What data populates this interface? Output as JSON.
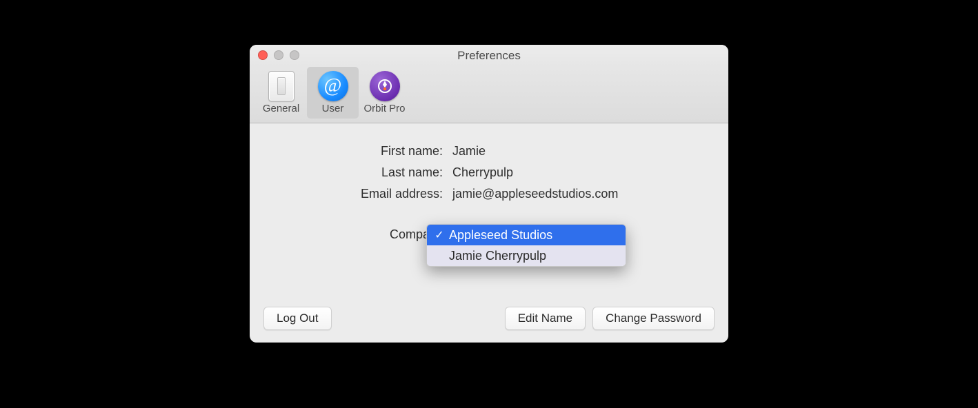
{
  "window": {
    "title": "Preferences"
  },
  "tabs": {
    "general": "General",
    "user": "User",
    "orbit": "Orbit Pro"
  },
  "form": {
    "first_name_label": "First name:",
    "first_name_value": "Jamie",
    "last_name_label": "Last name:",
    "last_name_value": "Cherrypulp",
    "email_label": "Email address:",
    "email_value": "jamie@appleseedstudios.com",
    "company_label": "Company"
  },
  "company_dropdown": {
    "options": [
      {
        "label": "Appleseed Studios",
        "selected": true
      },
      {
        "label": "Jamie Cherrypulp",
        "selected": false
      }
    ]
  },
  "buttons": {
    "logout": "Log Out",
    "edit_name": "Edit Name",
    "change_password": "Change Password"
  }
}
